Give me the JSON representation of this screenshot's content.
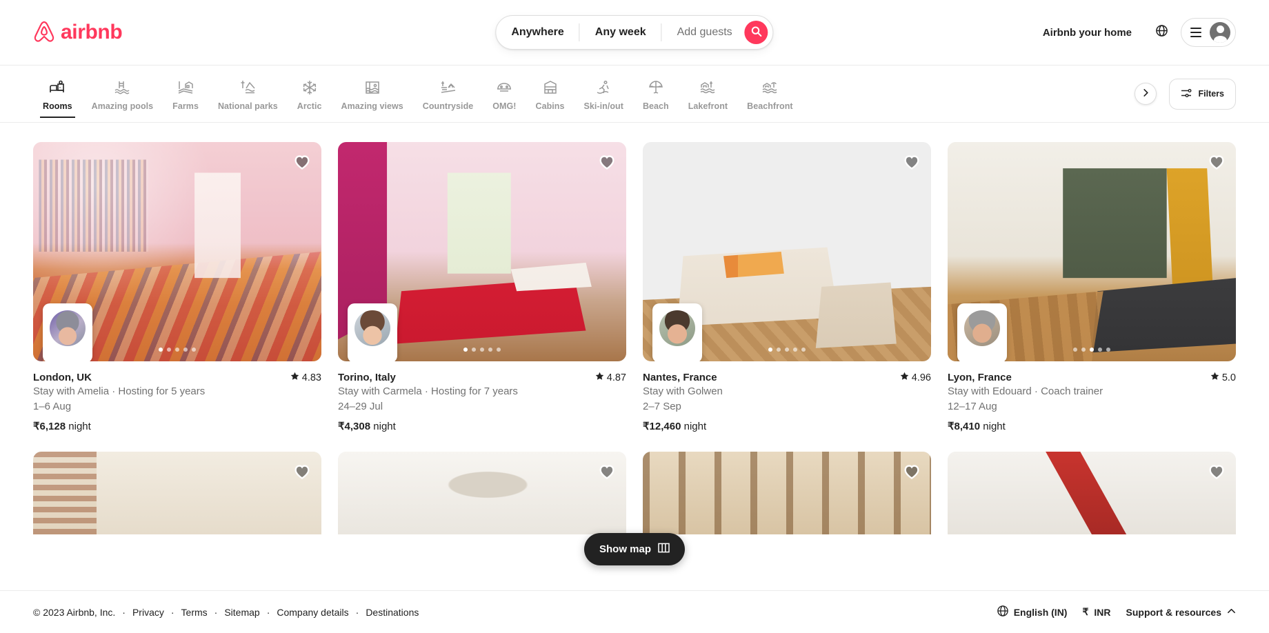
{
  "header": {
    "brand": "airbnb",
    "search": {
      "where": "Anywhere",
      "when": "Any week",
      "guests_placeholder": "Add guests",
      "search_icon": "search-icon"
    },
    "host_link": "Airbnb your home",
    "globe_icon": "globe-icon",
    "menu_icon": "hamburger-icon",
    "avatar_icon": "user-avatar-icon",
    "accent_color": "#FF385C"
  },
  "categories": {
    "active": "Rooms",
    "items": [
      {
        "label": "Rooms",
        "icon": "bed-icon"
      },
      {
        "label": "Amazing pools",
        "icon": "pool-icon"
      },
      {
        "label": "Farms",
        "icon": "farm-icon"
      },
      {
        "label": "National parks",
        "icon": "national-park-icon"
      },
      {
        "label": "Arctic",
        "icon": "snowflake-icon"
      },
      {
        "label": "Amazing views",
        "icon": "view-frame-icon"
      },
      {
        "label": "Countryside",
        "icon": "countryside-icon"
      },
      {
        "label": "OMG!",
        "icon": "omg-icon"
      },
      {
        "label": "Cabins",
        "icon": "cabin-icon"
      },
      {
        "label": "Ski-in/out",
        "icon": "ski-icon"
      },
      {
        "label": "Beach",
        "icon": "beach-umbrella-icon"
      },
      {
        "label": "Lakefront",
        "icon": "lakefront-icon"
      },
      {
        "label": "Beachfront",
        "icon": "beachfront-icon"
      }
    ],
    "next_icon": "chevron-right-icon",
    "filters_label": "Filters",
    "filters_icon": "sliders-icon"
  },
  "listings": [
    {
      "city": "London, UK",
      "rating": "4.83",
      "host": "Stay with Amelia · Hosting for 5 years",
      "dates": "1–6 Aug",
      "price": "₹6,128",
      "price_unit": "night",
      "active_dot": 0,
      "dot_count": 5
    },
    {
      "city": "Torino, Italy",
      "rating": "4.87",
      "host": "Stay with Carmela · Hosting for 7 years",
      "dates": "24–29 Jul",
      "price": "₹4,308",
      "price_unit": "night",
      "active_dot": 0,
      "dot_count": 5
    },
    {
      "city": "Nantes, France",
      "rating": "4.96",
      "host": "Stay with Golwen",
      "dates": "2–7 Sep",
      "price": "₹12,460",
      "price_unit": "night",
      "active_dot": 0,
      "dot_count": 5
    },
    {
      "city": "Lyon, France",
      "rating": "5.0",
      "host": "Stay with Edouard · Coach trainer",
      "dates": "12–17 Aug",
      "price": "₹8,410",
      "price_unit": "night",
      "active_dot": 2,
      "dot_count": 5
    }
  ],
  "show_map": {
    "label": "Show map",
    "icon": "map-icon"
  },
  "footer": {
    "copyright": "© 2023 Airbnb, Inc.",
    "links": [
      "Privacy",
      "Terms",
      "Sitemap",
      "Company details",
      "Destinations"
    ],
    "language": "English (IN)",
    "language_icon": "globe-icon",
    "currency_symbol": "₹",
    "currency_code": "INR",
    "support": "Support & resources",
    "support_icon": "chevron-up-icon"
  }
}
